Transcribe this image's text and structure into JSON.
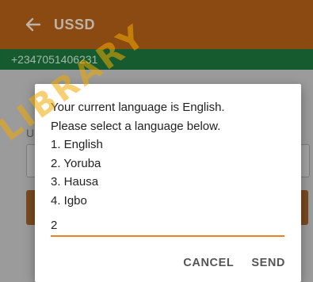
{
  "app_bar": {
    "title": "USSD",
    "back_icon": "arrow-left-icon",
    "color": "#8a4a12"
  },
  "number_bar": {
    "number": "+2347051406231",
    "color": "#165a2f"
  },
  "dialog": {
    "lines": [
      "Your current language is English.",
      "Please select a language below.",
      "1. English",
      "2. Yoruba",
      "3. Hausa",
      "4. Igbo"
    ],
    "input_value": "2",
    "accent": "#e8821e",
    "cancel_label": "CANCEL",
    "send_label": "SEND"
  },
  "watermark": "LIBRARY"
}
